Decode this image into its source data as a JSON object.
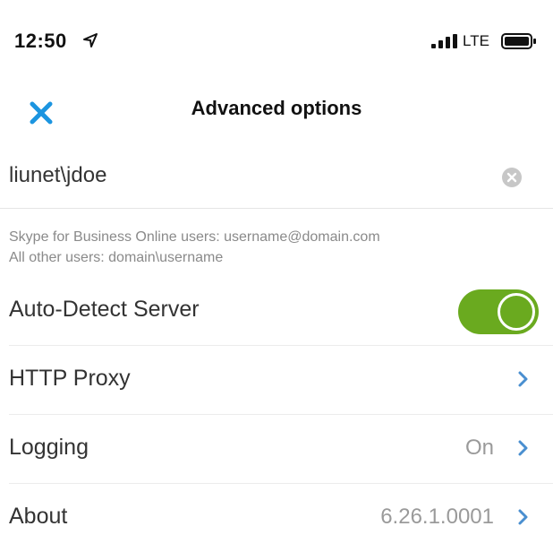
{
  "status_bar": {
    "time": "12:50",
    "network": "LTE",
    "icons": [
      "location-arrow-icon",
      "signal-bars-icon",
      "battery-icon"
    ]
  },
  "nav": {
    "title": "Advanced options",
    "close_icon": "close-x-icon",
    "accent": "#1c95e0"
  },
  "username_field": {
    "value": "liunet\\jdoe",
    "clear_icon": "clear-circle-icon"
  },
  "hint": {
    "line1": "Skype for Business Online users: username@domain.com",
    "line2": "All other users: domain\\username"
  },
  "settings": {
    "auto_detect": {
      "label": "Auto-Detect Server",
      "enabled": true,
      "color": "#6aaa1f"
    },
    "http_proxy": {
      "label": "HTTP Proxy"
    },
    "logging": {
      "label": "Logging",
      "value": "On"
    },
    "about": {
      "label": "About",
      "value": "6.26.1.0001"
    }
  }
}
